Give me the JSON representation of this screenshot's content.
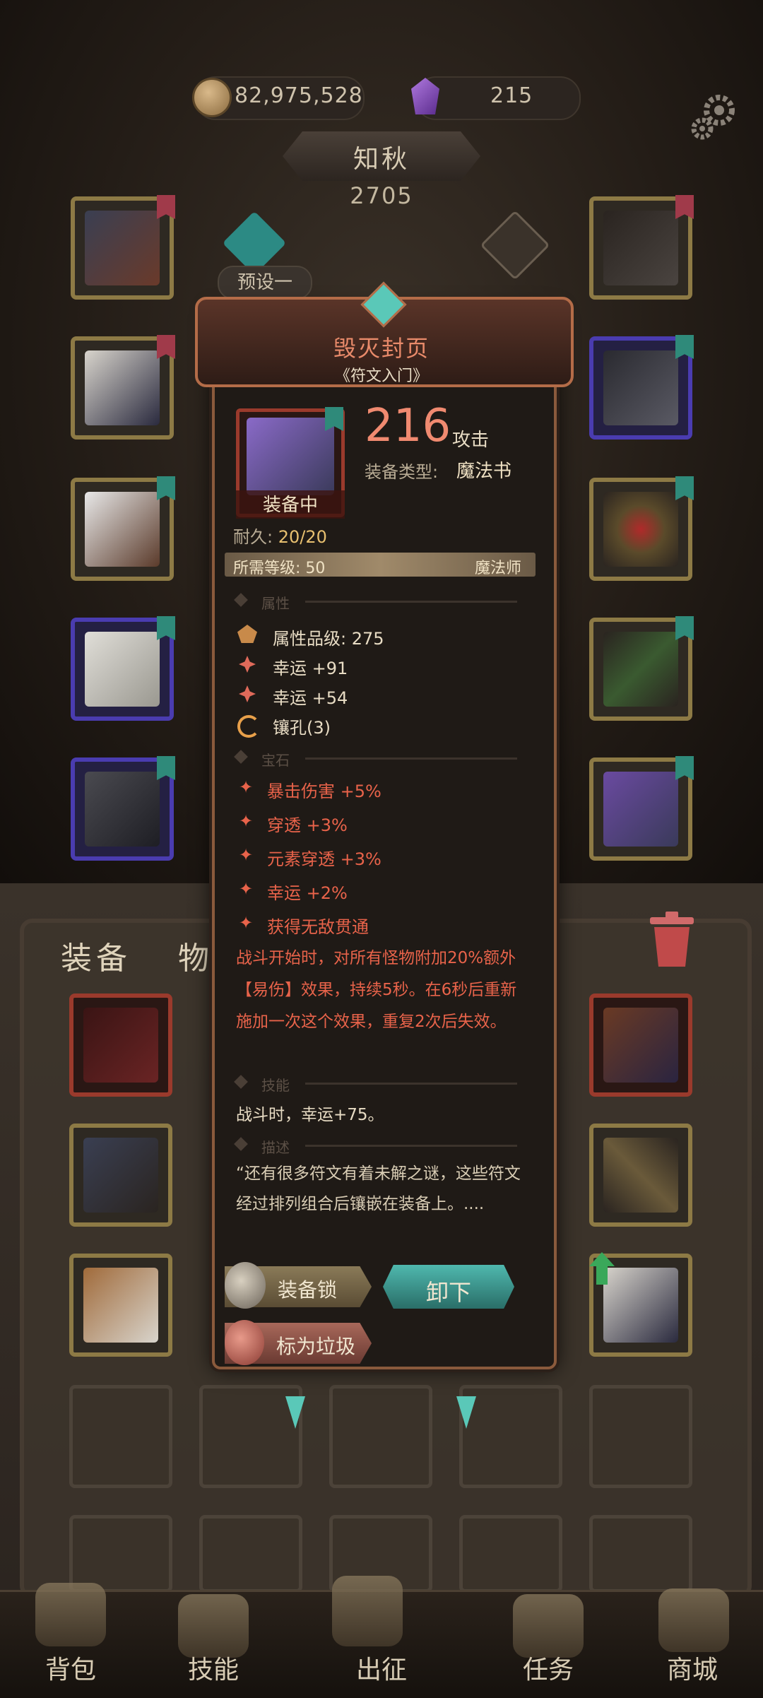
{
  "currency": {
    "gold": "82,975,528",
    "gems": "215"
  },
  "hero": {
    "name": "知秋",
    "power": "2705",
    "preset": "预设一"
  },
  "colors": {
    "gem_text": "#e8634a",
    "accent_title": "#e88a6a",
    "unequip_button": "#4fb8ae"
  },
  "tabs": {
    "equipment": "装备",
    "items": "物品"
  },
  "tooltip": {
    "name": "毁灭封页",
    "subtitle": "《符文入门》",
    "equipped_label": "装备中",
    "attack_value": "216",
    "attack_label": "攻击",
    "type_label": "装备类型:",
    "type_value": "魔法书",
    "durability_label": "耐久:",
    "durability_value": "20/20",
    "level_label": "所需等级: 50",
    "class": "魔法师",
    "sections": {
      "attributes": "属性",
      "gems": "宝石",
      "skill": "技能",
      "description": "描述"
    },
    "attributes": [
      "属性品级: 275",
      "幸运 +91",
      "幸运 +54",
      "镶孔(3)"
    ],
    "gems": [
      "暴击伤害 +5%",
      "穿透 +3%",
      "元素穿透 +3%",
      "幸运 +2%",
      "获得无敌贯通"
    ],
    "gem_effect": "战斗开始时，对所有怪物附加20%额外【易伤】效果，持续5秒。在6秒后重新施加一次这个效果，重复2次后失效。",
    "skill": "战斗时，幸运+75。",
    "flavor": "“还有很多符文有着未解之谜，这些符文经过排列组合后镶嵌在装备上。....",
    "buttons": {
      "lock": "装备锁",
      "unequip": "卸下",
      "trash": "标为垃圾"
    }
  },
  "bottom_nav": [
    "背包",
    "技能",
    "出征",
    "任务",
    "商城"
  ]
}
